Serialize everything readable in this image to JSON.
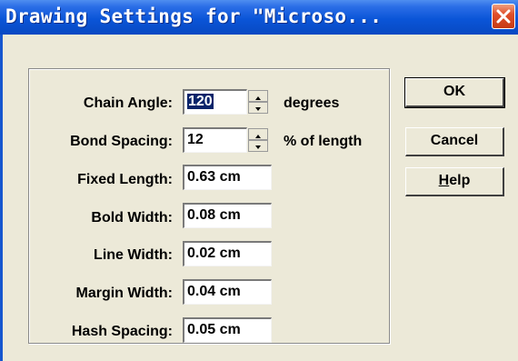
{
  "window": {
    "title": "Drawing Settings for \"Microso..."
  },
  "fields": [
    {
      "label": "Chain Angle:",
      "value": "120",
      "selected": true,
      "spinner": true,
      "unit": "degrees"
    },
    {
      "label": "Bond Spacing:",
      "value": "12",
      "spinner": true,
      "unit": "% of length"
    },
    {
      "label": "Fixed Length:",
      "value": "0.63 cm"
    },
    {
      "label": "Bold Width:",
      "value": "0.08 cm"
    },
    {
      "label": "Line Width:",
      "value": "0.02 cm"
    },
    {
      "label": "Margin Width:",
      "value": "0.04 cm"
    },
    {
      "label": "Hash Spacing:",
      "value": "0.05 cm"
    }
  ],
  "buttons": {
    "ok": "OK",
    "cancel": "Cancel",
    "help_mnemonic": "H",
    "help_rest": "elp"
  }
}
